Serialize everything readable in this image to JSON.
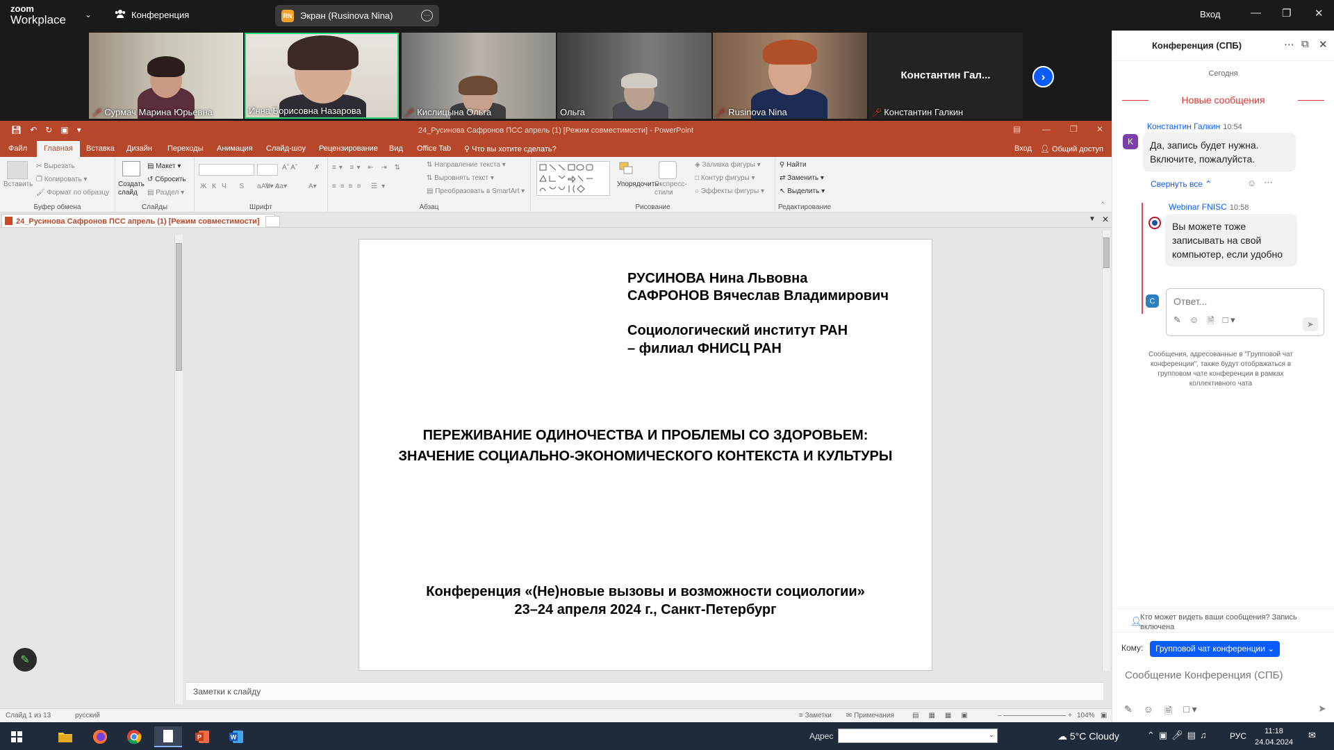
{
  "zoom": {
    "logo_line1": "zoom",
    "logo_line2": "Workplace",
    "meeting_label": "Конференция",
    "screen_share_label": "Экран (Rusinova Nina)",
    "screen_share_avatar": "RN",
    "login_label": "Вход",
    "accent": "#0b5cff"
  },
  "participants": [
    {
      "name": "Сурмач Марина Юрьевна",
      "muted": true
    },
    {
      "name": "Инна Борисовна Назарова",
      "muted": false,
      "active_speaker": true
    },
    {
      "name": "Кислицына Ольга",
      "muted": true
    },
    {
      "name": "Ольга",
      "muted": false
    },
    {
      "name": "Rusinova Nina",
      "muted": true
    },
    {
      "name": "Константин Галкин",
      "muted": true,
      "video_off": true,
      "display_name": "Константин  Гал..."
    }
  ],
  "ppt": {
    "window_title": "24_Русинова Сафронов  ПСС апрель (1) [Режим совместимости] - PowerPoint",
    "brand_color": "#b7472a",
    "tabs": [
      "Файл",
      "Главная",
      "Вставка",
      "Дизайн",
      "Переходы",
      "Анимация",
      "Слайд-шоу",
      "Рецензирование",
      "Вид",
      "Office Tab"
    ],
    "active_tab": "Главная",
    "tell_me": "Что вы хотите сделать?",
    "sign_in": "Вход",
    "share": "Общий доступ",
    "ribbon": {
      "clipboard": {
        "label": "Буфер обмена",
        "paste": "Вставить",
        "cut": "Вырезать",
        "copy": "Копировать",
        "format_painter": "Формат по образцу"
      },
      "slides": {
        "label": "Слайды",
        "new_slide": "Создать слайд",
        "layout": "Макет",
        "reset": "Сбросить",
        "section": "Раздел"
      },
      "font": {
        "label": "Шрифт"
      },
      "paragraph": {
        "label": "Абзац",
        "text_direction": "Направление текста",
        "align_text": "Выровнять текст",
        "smartart": "Преобразовать в SmartArt"
      },
      "drawing": {
        "label": "Рисование",
        "arrange": "Упорядочить",
        "quick_styles": "Экспресс-стили",
        "fill": "Заливка фигуры",
        "outline": "Контур фигуры",
        "effects": "Эффекты фигуры"
      },
      "editing": {
        "label": "Редактирование",
        "find": "Найти",
        "replace": "Заменить",
        "select": "Выделить"
      }
    },
    "doc_tab": "24_Русинова Сафронов  ПСС апрель (1) [Режим совместимости]",
    "slide": {
      "author1": "РУСИНОВА Нина Львовна",
      "author2": "САФРОНОВ Вячеслав Владимирович",
      "inst1": "Социологический институт РАН",
      "inst2": "– филиал ФНИСЦ РАН",
      "title1": "ПЕРЕЖИВАНИЕ ОДИНОЧЕСТВА И ПРОБЛЕМЫ СО ЗДОРОВЬЕМ:",
      "title2": "ЗНАЧЕНИЕ СОЦИАЛЬНО-ЭКОНОМИЧЕСКОГО КОНТЕКСТА И КУЛЬТУРЫ",
      "conf1": "Конференция «(Не)новые вызовы и возможности социологии»",
      "conf2": "23–24 апреля 2024 г., Санкт-Петербург"
    },
    "notes_placeholder": "Заметки к слайду",
    "status": {
      "slide_count": "Слайд 1 из 13",
      "language": "русский",
      "notes": "Заметки",
      "comments": "Примечания",
      "zoom": "104%"
    }
  },
  "chat": {
    "title": "Конференция (СПБ)",
    "today": "Сегодня",
    "new_messages": "Новые сообщения",
    "messages": [
      {
        "sender": "Константин Галкин",
        "time": "10:54",
        "avatar": "K",
        "avatar_color": "#7b3fa8",
        "text": "Да, запись будет нужна. Включите, пожалуйста."
      },
      {
        "sender": "Webinar FNISC",
        "time": "10:58",
        "avatar": "",
        "text": "Вы можете тоже записывать на свой компьютер, если удобно"
      }
    ],
    "collapse_all": "Свернуть все",
    "reply_avatar": "C",
    "reply_placeholder": "Ответ...",
    "group_note": "Сообщения, адресованные в \"Групповой чат конференции\", также будут отображаться в групповом чате конференции в рамках коллективного чата",
    "who_sees": "Кто может видеть ваши сообщения? Запись включена",
    "to_label": "Кому:",
    "to_value": "Групповой чат конференции",
    "compose_placeholder": "Сообщение Конференция (СПБ)"
  },
  "taskbar": {
    "address_label": "Адрес",
    "weather": "5°C  Cloudy",
    "language": "РУС",
    "time": "11:18",
    "date": "24.04.2024"
  }
}
